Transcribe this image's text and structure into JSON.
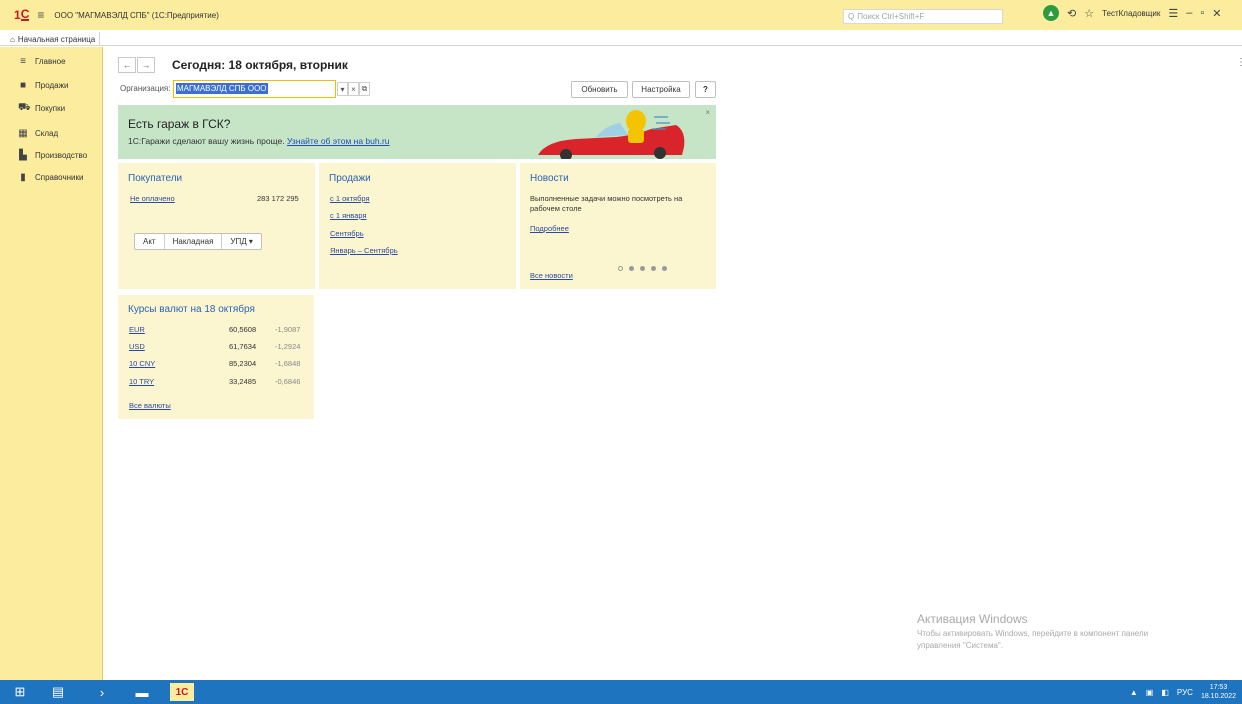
{
  "titlebar": {
    "app_title": "ООО \"МАГМАВЭЛД СПБ\" (1С:Предприятие)",
    "search_placeholder": "Поиск Ctrl+Shift+F",
    "user": "ТестКладовщик"
  },
  "tabs": [
    {
      "label": "Начальная страница"
    }
  ],
  "sidebar": {
    "items": [
      {
        "label": "Главное",
        "icon": "menu-lines-icon"
      },
      {
        "label": "Продажи",
        "icon": "briefcase-icon"
      },
      {
        "label": "Покупки",
        "icon": "cart-icon"
      },
      {
        "label": "Склад",
        "icon": "warehouse-icon"
      },
      {
        "label": "Производство",
        "icon": "factory-icon"
      },
      {
        "label": "Справочники",
        "icon": "book-icon"
      }
    ]
  },
  "main": {
    "title": "Сегодня: 18 октября, вторник",
    "org_label": "Организация:",
    "org_value": "МАГМАВЭЛД СПБ ООО",
    "refresh_label": "Обновить",
    "settings_label": "Настройка",
    "help_label": "?"
  },
  "banner": {
    "title": "Есть гараж в ГСК?",
    "text": "1С:Гаражи сделают вашу жизнь проще.",
    "link": "Узнайте об этом на buh.ru"
  },
  "buyers": {
    "title": "Покупатели",
    "unpaid_label": "Не оплачено",
    "unpaid_value": "283 172 295",
    "buttons": [
      "Акт",
      "Накладная",
      "УПД ▾"
    ]
  },
  "sales": {
    "title": "Продажи",
    "links": [
      "с 1 октября",
      "с 1 января",
      "Сентябрь",
      "Январь – Сентябрь"
    ]
  },
  "news": {
    "title": "Новости",
    "text_line1": "Выполненные задачи можно посмотреть на",
    "text_line2": "рабочем столе",
    "more": "Подробнее",
    "all": "Все новости"
  },
  "rates": {
    "title": "Курсы валют на 18 октября",
    "rows": [
      {
        "code": "EUR",
        "rate": "60,5608",
        "change": "-1,9087"
      },
      {
        "code": "USD",
        "rate": "61,7634",
        "change": "-1,2924"
      },
      {
        "code": "10 CNY",
        "rate": "85,2304",
        "change": "-1,6848"
      },
      {
        "code": "10 TRY",
        "rate": "33,2485",
        "change": "-0,6846"
      }
    ],
    "all": "Все валюты"
  },
  "activation": {
    "title": "Активация Windows",
    "line1": "Чтобы активировать Windows, перейдите в компонент панели",
    "line2": "управления \"Система\"."
  },
  "taskbar": {
    "lang": "РУС",
    "time": "17:53",
    "date": "18.10.2022"
  },
  "colors": {
    "accent_yellow": "#fbec9e",
    "panel_bg": "#fbf5d0",
    "banner_bg": "#c6e5c7",
    "link_blue": "#2b4aa0",
    "taskbar_blue": "#1e74bf"
  }
}
